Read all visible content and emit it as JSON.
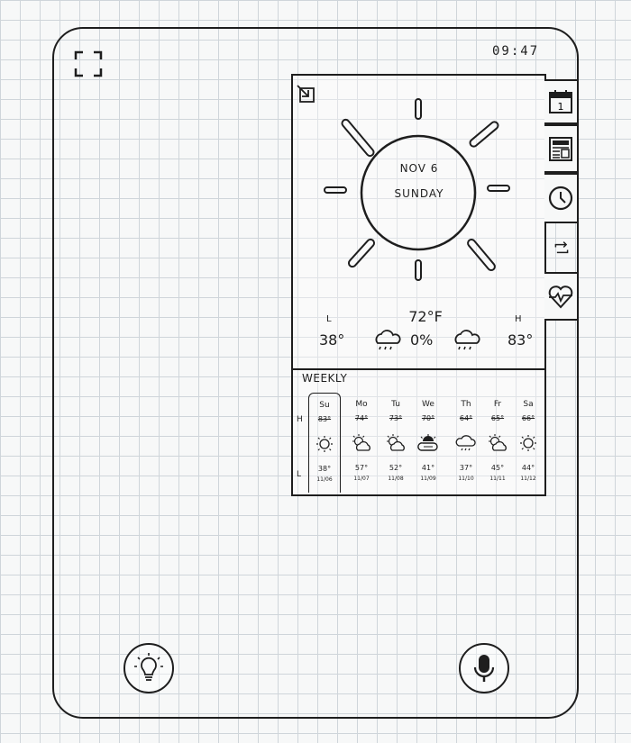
{
  "status_bar": {
    "time": "09:47"
  },
  "today": {
    "date": "NOV 6",
    "day": "SUNDAY",
    "temperature": "72°F",
    "low_label": "L",
    "high_label": "H",
    "low": "38°",
    "high": "83°",
    "precipitation": "0%"
  },
  "weekly": {
    "label": "WEEKLY",
    "high_row_label": "H",
    "low_row_label": "L",
    "days": [
      {
        "name": "Su",
        "high": "83°",
        "low": "38°",
        "date": "11/06",
        "icon": "sun-icon"
      },
      {
        "name": "Mo",
        "high": "74°",
        "low": "57°",
        "date": "11/07",
        "icon": "partly-cloudy-icon"
      },
      {
        "name": "Tu",
        "high": "73°",
        "low": "52°",
        "date": "11/08",
        "icon": "partly-cloudy-icon"
      },
      {
        "name": "We",
        "high": "70°",
        "low": "41°",
        "date": "11/09",
        "icon": "cloud-sun-icon"
      },
      {
        "name": "Th",
        "high": "64°",
        "low": "37°",
        "date": "11/10",
        "icon": "rain-icon"
      },
      {
        "name": "Fr",
        "high": "65°",
        "low": "45°",
        "date": "11/11",
        "icon": "partly-cloudy-icon"
      },
      {
        "name": "Sa",
        "high": "66°",
        "low": "44°",
        "date": "11/12",
        "icon": "sun-icon"
      }
    ]
  },
  "side_tabs": [
    {
      "id": "calendar",
      "icon": "calendar-icon",
      "number": "1"
    },
    {
      "id": "news",
      "icon": "newspaper-icon"
    },
    {
      "id": "clock",
      "icon": "clock-icon"
    },
    {
      "id": "repeat",
      "icon": "repeat-icon"
    },
    {
      "id": "health",
      "icon": "heart-pulse-icon"
    }
  ],
  "colors": {
    "ink": "#1e1e1e",
    "grid": "#cfd5da",
    "paper": "#f7f8f8"
  }
}
